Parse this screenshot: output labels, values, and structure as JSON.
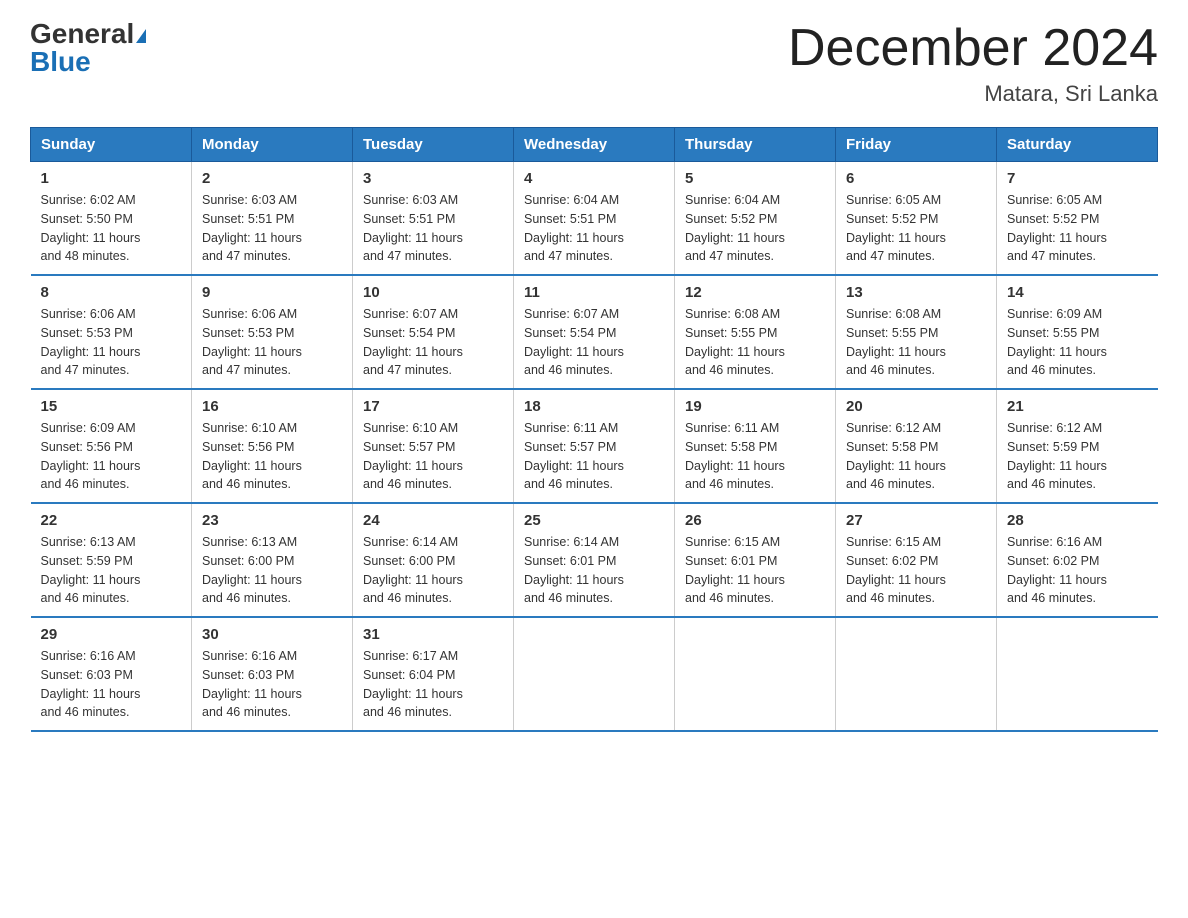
{
  "header": {
    "logo_general": "General",
    "logo_blue": "Blue",
    "month_title": "December 2024",
    "location": "Matara, Sri Lanka"
  },
  "days_of_week": [
    "Sunday",
    "Monday",
    "Tuesday",
    "Wednesday",
    "Thursday",
    "Friday",
    "Saturday"
  ],
  "weeks": [
    [
      {
        "day": "1",
        "sunrise": "6:02 AM",
        "sunset": "5:50 PM",
        "daylight": "11 hours and 48 minutes."
      },
      {
        "day": "2",
        "sunrise": "6:03 AM",
        "sunset": "5:51 PM",
        "daylight": "11 hours and 47 minutes."
      },
      {
        "day": "3",
        "sunrise": "6:03 AM",
        "sunset": "5:51 PM",
        "daylight": "11 hours and 47 minutes."
      },
      {
        "day": "4",
        "sunrise": "6:04 AM",
        "sunset": "5:51 PM",
        "daylight": "11 hours and 47 minutes."
      },
      {
        "day": "5",
        "sunrise": "6:04 AM",
        "sunset": "5:52 PM",
        "daylight": "11 hours and 47 minutes."
      },
      {
        "day": "6",
        "sunrise": "6:05 AM",
        "sunset": "5:52 PM",
        "daylight": "11 hours and 47 minutes."
      },
      {
        "day": "7",
        "sunrise": "6:05 AM",
        "sunset": "5:52 PM",
        "daylight": "11 hours and 47 minutes."
      }
    ],
    [
      {
        "day": "8",
        "sunrise": "6:06 AM",
        "sunset": "5:53 PM",
        "daylight": "11 hours and 47 minutes."
      },
      {
        "day": "9",
        "sunrise": "6:06 AM",
        "sunset": "5:53 PM",
        "daylight": "11 hours and 47 minutes."
      },
      {
        "day": "10",
        "sunrise": "6:07 AM",
        "sunset": "5:54 PM",
        "daylight": "11 hours and 47 minutes."
      },
      {
        "day": "11",
        "sunrise": "6:07 AM",
        "sunset": "5:54 PM",
        "daylight": "11 hours and 46 minutes."
      },
      {
        "day": "12",
        "sunrise": "6:08 AM",
        "sunset": "5:55 PM",
        "daylight": "11 hours and 46 minutes."
      },
      {
        "day": "13",
        "sunrise": "6:08 AM",
        "sunset": "5:55 PM",
        "daylight": "11 hours and 46 minutes."
      },
      {
        "day": "14",
        "sunrise": "6:09 AM",
        "sunset": "5:55 PM",
        "daylight": "11 hours and 46 minutes."
      }
    ],
    [
      {
        "day": "15",
        "sunrise": "6:09 AM",
        "sunset": "5:56 PM",
        "daylight": "11 hours and 46 minutes."
      },
      {
        "day": "16",
        "sunrise": "6:10 AM",
        "sunset": "5:56 PM",
        "daylight": "11 hours and 46 minutes."
      },
      {
        "day": "17",
        "sunrise": "6:10 AM",
        "sunset": "5:57 PM",
        "daylight": "11 hours and 46 minutes."
      },
      {
        "day": "18",
        "sunrise": "6:11 AM",
        "sunset": "5:57 PM",
        "daylight": "11 hours and 46 minutes."
      },
      {
        "day": "19",
        "sunrise": "6:11 AM",
        "sunset": "5:58 PM",
        "daylight": "11 hours and 46 minutes."
      },
      {
        "day": "20",
        "sunrise": "6:12 AM",
        "sunset": "5:58 PM",
        "daylight": "11 hours and 46 minutes."
      },
      {
        "day": "21",
        "sunrise": "6:12 AM",
        "sunset": "5:59 PM",
        "daylight": "11 hours and 46 minutes."
      }
    ],
    [
      {
        "day": "22",
        "sunrise": "6:13 AM",
        "sunset": "5:59 PM",
        "daylight": "11 hours and 46 minutes."
      },
      {
        "day": "23",
        "sunrise": "6:13 AM",
        "sunset": "6:00 PM",
        "daylight": "11 hours and 46 minutes."
      },
      {
        "day": "24",
        "sunrise": "6:14 AM",
        "sunset": "6:00 PM",
        "daylight": "11 hours and 46 minutes."
      },
      {
        "day": "25",
        "sunrise": "6:14 AM",
        "sunset": "6:01 PM",
        "daylight": "11 hours and 46 minutes."
      },
      {
        "day": "26",
        "sunrise": "6:15 AM",
        "sunset": "6:01 PM",
        "daylight": "11 hours and 46 minutes."
      },
      {
        "day": "27",
        "sunrise": "6:15 AM",
        "sunset": "6:02 PM",
        "daylight": "11 hours and 46 minutes."
      },
      {
        "day": "28",
        "sunrise": "6:16 AM",
        "sunset": "6:02 PM",
        "daylight": "11 hours and 46 minutes."
      }
    ],
    [
      {
        "day": "29",
        "sunrise": "6:16 AM",
        "sunset": "6:03 PM",
        "daylight": "11 hours and 46 minutes."
      },
      {
        "day": "30",
        "sunrise": "6:16 AM",
        "sunset": "6:03 PM",
        "daylight": "11 hours and 46 minutes."
      },
      {
        "day": "31",
        "sunrise": "6:17 AM",
        "sunset": "6:04 PM",
        "daylight": "11 hours and 46 minutes."
      },
      null,
      null,
      null,
      null
    ]
  ],
  "labels": {
    "sunrise": "Sunrise:",
    "sunset": "Sunset:",
    "daylight": "Daylight:"
  }
}
